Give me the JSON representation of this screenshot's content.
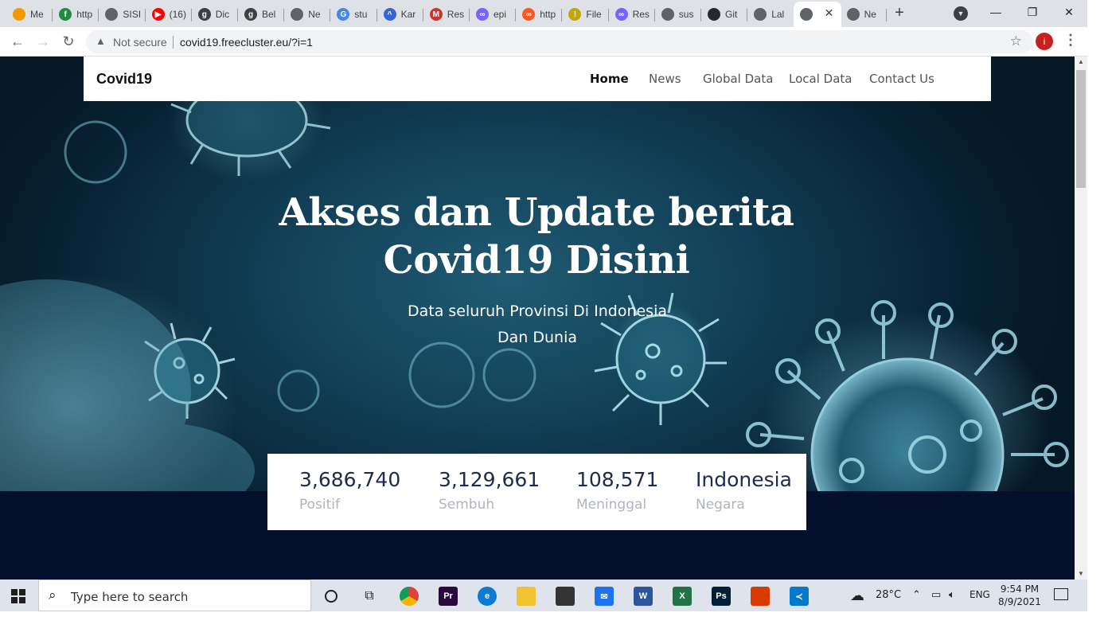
{
  "browser": {
    "tabs": [
      {
        "title": "Me",
        "fav_color": "#f29900",
        "fav_glyph": ""
      },
      {
        "title": "http",
        "fav_color": "#1e8e3e",
        "fav_glyph": "f"
      },
      {
        "title": "SISI",
        "fav_color": "#5f6368",
        "fav_glyph": ""
      },
      {
        "title": "(16)",
        "fav_color": "#ff0000",
        "fav_glyph": "▶"
      },
      {
        "title": "Dic",
        "fav_color": "#3c4043",
        "fav_glyph": "g"
      },
      {
        "title": "Bel",
        "fav_color": "#3c4043",
        "fav_glyph": "g"
      },
      {
        "title": "Ne",
        "fav_color": "#5f6368",
        "fav_glyph": ""
      },
      {
        "title": "stu",
        "fav_color": "#4285f4",
        "fav_glyph": "G"
      },
      {
        "title": "Kar",
        "fav_color": "#3367d6",
        "fav_glyph": "^"
      },
      {
        "title": "Res",
        "fav_color": "#d93025",
        "fav_glyph": "M"
      },
      {
        "title": "epi",
        "fav_color": "#7b61ff",
        "fav_glyph": "∞"
      },
      {
        "title": "http",
        "fav_color": "#ff5722",
        "fav_glyph": "∞"
      },
      {
        "title": "File",
        "fav_color": "#c5a600",
        "fav_glyph": "!"
      },
      {
        "title": "Res",
        "fav_color": "#7b61ff",
        "fav_glyph": "∞"
      },
      {
        "title": "sus",
        "fav_color": "#5f6368",
        "fav_glyph": ""
      },
      {
        "title": "Git",
        "fav_color": "#24292e",
        "fav_glyph": ""
      },
      {
        "title": "Lal",
        "fav_color": "#5f6368",
        "fav_glyph": ""
      },
      {
        "title": "",
        "fav_color": "#5f6368",
        "fav_glyph": ""
      },
      {
        "title": "Ne",
        "fav_color": "#5f6368",
        "fav_glyph": ""
      }
    ],
    "new_tab_label": "+",
    "tab_close": "✕",
    "window": {
      "minimize": "—",
      "maximize": "❐",
      "close": "✕"
    },
    "not_secure_label": "Not secure",
    "url": "covid19.freecluster.eu/?i=1",
    "profile_initial": "i"
  },
  "site": {
    "brand": "Covid19",
    "nav": [
      "Home",
      "News",
      "Global Data",
      "Local Data",
      "Contact Us"
    ],
    "hero": {
      "title_line1": "Akses dan Update berita",
      "title_line2": "Covid19 Disini",
      "subtitle_line1": "Data seluruh Provinsi Di Indonesia",
      "subtitle_line2": "Dan Dunia"
    },
    "stats": [
      {
        "value": "3,686,740",
        "label": "Positif"
      },
      {
        "value": "3,129,661",
        "label": "Sembuh"
      },
      {
        "value": "108,571",
        "label": "Meninggal"
      },
      {
        "value": "Indonesia",
        "label": "Negara"
      }
    ]
  },
  "taskbar": {
    "search_placeholder": "Type here to search",
    "weather": "28°C",
    "language": "ENG",
    "time": "9:54 PM",
    "date": "8/9/2021",
    "apps": [
      {
        "name": "chrome",
        "glyph": "",
        "color": "#4285f4",
        "running": true
      },
      {
        "name": "premiere",
        "glyph": "Pr",
        "color": "#2a0a3d",
        "running": false
      },
      {
        "name": "edge",
        "glyph": "e",
        "color": "#0c7bd6",
        "running": false
      },
      {
        "name": "file-explorer",
        "glyph": "",
        "color": "#f2c230",
        "running": true
      },
      {
        "name": "store",
        "glyph": "",
        "color": "#333333",
        "running": false
      },
      {
        "name": "mail",
        "glyph": "✉",
        "color": "#1a73e8",
        "running": false
      },
      {
        "name": "word",
        "glyph": "W",
        "color": "#2b579a",
        "running": false
      },
      {
        "name": "excel",
        "glyph": "X",
        "color": "#217346",
        "running": false
      },
      {
        "name": "photoshop",
        "glyph": "Ps",
        "color": "#001e36",
        "running": false
      },
      {
        "name": "office",
        "glyph": "",
        "color": "#d83b01",
        "running": false
      },
      {
        "name": "vscode",
        "glyph": "≺",
        "color": "#007acc",
        "running": true
      }
    ]
  }
}
